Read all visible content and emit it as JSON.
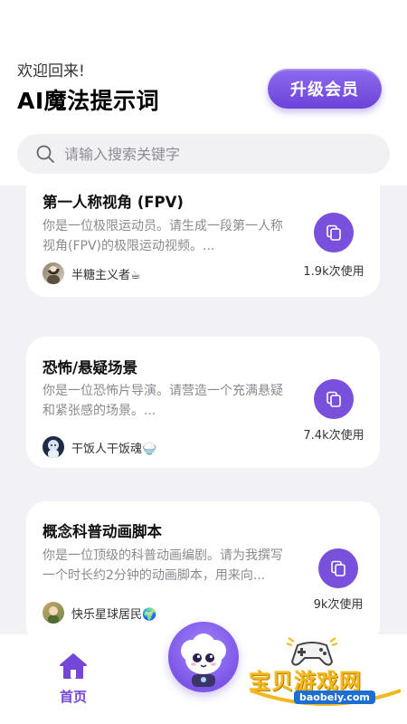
{
  "header": {
    "welcome": "欢迎回来!",
    "title": "AI魔法提示词",
    "upgrade_label": "升级会员"
  },
  "search": {
    "placeholder": "请输入搜索关键字",
    "value": ""
  },
  "cards": [
    {
      "title": "第一人称视角 (FPV)",
      "description": "你是一位极限运动员。请生成一段第一人称视角(FPV)的极限运动视频。...",
      "author": "半糖主义者☕",
      "usage": "1.9k次使用"
    },
    {
      "title": "恐怖/悬疑场景",
      "description": "你是一位恐怖片导演。请营造一个充满悬疑和紧张感的场景。...",
      "author": "干饭人干饭魂🍚",
      "usage": "7.4k次使用"
    },
    {
      "title": "概念科普动画脚本",
      "description": "你是一位顶级的科普动画编剧。请为我撰写一个时长约2分钟的动画脚本，用来向...",
      "author": "快乐星球居民🌍",
      "usage": "9k次使用"
    }
  ],
  "bottom_nav": {
    "home_label": "首页"
  },
  "watermark": {
    "text": "宝贝游戏网",
    "url": "baobeiy.com"
  },
  "colors": {
    "accent": "#7950dc",
    "background": "#f2f2f6",
    "watermark": "#f3b81e"
  },
  "icons": [
    "search-icon",
    "copy-icon",
    "home-icon",
    "mascot-avatar",
    "gamepad-icon"
  ]
}
